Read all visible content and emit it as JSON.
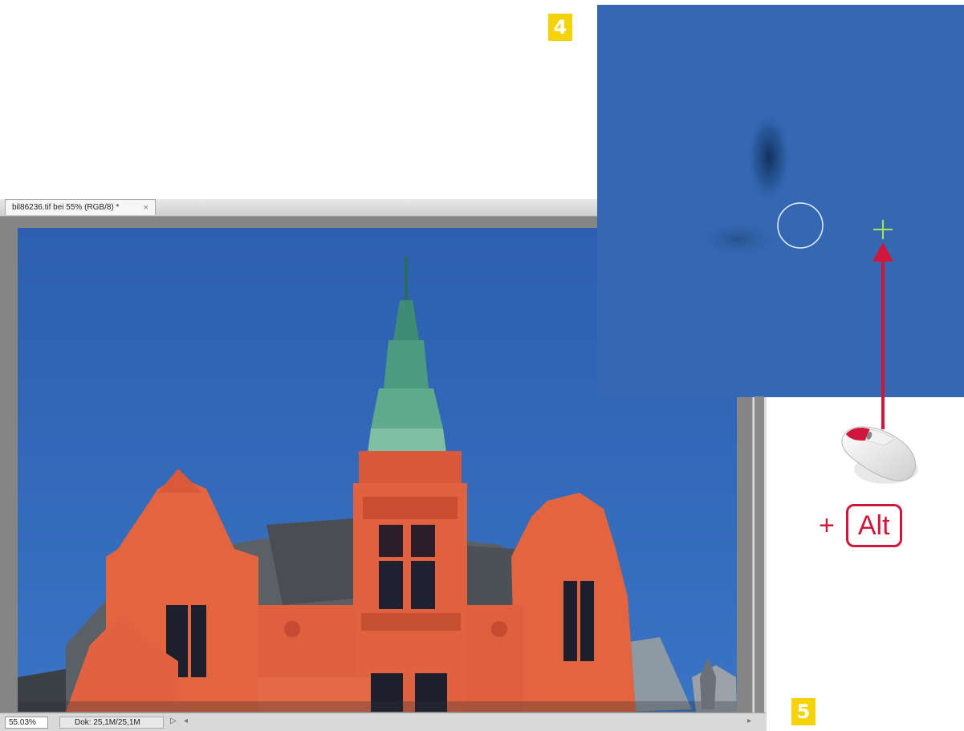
{
  "steps": {
    "step4": "4",
    "step5": "5"
  },
  "document": {
    "tab_title": "bil86236.tif bei 55% (RGB/8) *",
    "tab_close": "×",
    "zoom": "55.03%",
    "doc_size": "Dok: 25,1M/25,1M",
    "status_arrow": "▷",
    "scroll_left": "◂",
    "scroll_right": "▸"
  },
  "instruction": {
    "plus": "+",
    "key_label": "Alt"
  },
  "icons": {
    "mouse": "computer-mouse-icon",
    "crosshair": "crosshair-icon",
    "brush_cursor": "brush-circle-icon",
    "arrow": "arrow-up-icon"
  },
  "colors": {
    "accent": "#d0163a",
    "badge": "#f5d20a",
    "sky": "#2f66b8",
    "facade": "#e0623f",
    "crosshair": "#a8e05a"
  }
}
